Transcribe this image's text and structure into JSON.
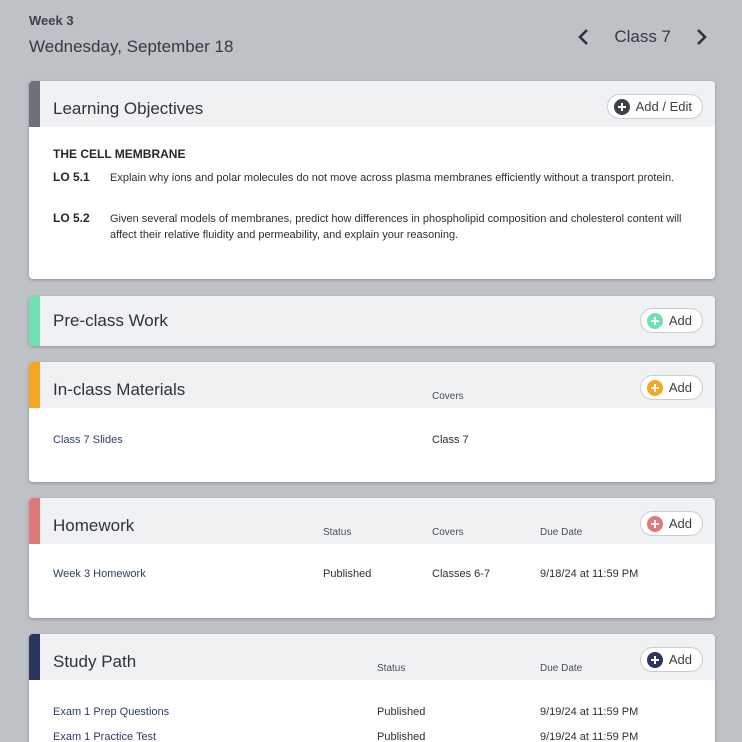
{
  "header": {
    "week": "Week 3",
    "date": "Wednesday, September 18",
    "class_label": "Class 7"
  },
  "objectives": {
    "title": "Learning Objectives",
    "add_label": "Add / Edit",
    "heading": "THE CELL MEMBRANE",
    "items": [
      {
        "num": "LO 5.1",
        "text": "Explain why ions and polar molecules do not move across plasma membranes efficiently without a transport protein."
      },
      {
        "num": "LO 5.2",
        "text": "Given several models of membranes, predict how differences in phospholipid composition and cholesterol content will affect their relative fluidity and permeability, and explain your reasoning."
      }
    ]
  },
  "preclass": {
    "title": "Pre-class Work",
    "add_label": "Add"
  },
  "inclass": {
    "title": "In-class Materials",
    "add_label": "Add",
    "col_covers": "Covers",
    "rows": [
      {
        "name": "Class 7 Slides",
        "covers": "Class 7"
      }
    ]
  },
  "homework": {
    "title": "Homework",
    "add_label": "Add",
    "col_status": "Status",
    "col_covers": "Covers",
    "col_due": "Due Date",
    "rows": [
      {
        "name": "Week 3 Homework",
        "status": "Published",
        "covers": "Classes 6-7",
        "due": "9/18/24 at 11:59 PM"
      }
    ]
  },
  "studypath": {
    "title": "Study Path",
    "add_label": "Add",
    "col_status": "Status",
    "col_due": "Due Date",
    "rows": [
      {
        "name": "Exam 1 Prep Questions",
        "status": "Published",
        "due": "9/19/24 at 11:59 PM"
      },
      {
        "name": "Exam 1 Practice Test",
        "status": "Published",
        "due": "9/19/24 at 11:59 PM"
      }
    ]
  },
  "colors": {
    "objectives": "#6c717a",
    "preclass": "#6fe0b0",
    "inclass": "#f5a623",
    "homework": "#e07a78",
    "studypath": "#2a3660"
  }
}
